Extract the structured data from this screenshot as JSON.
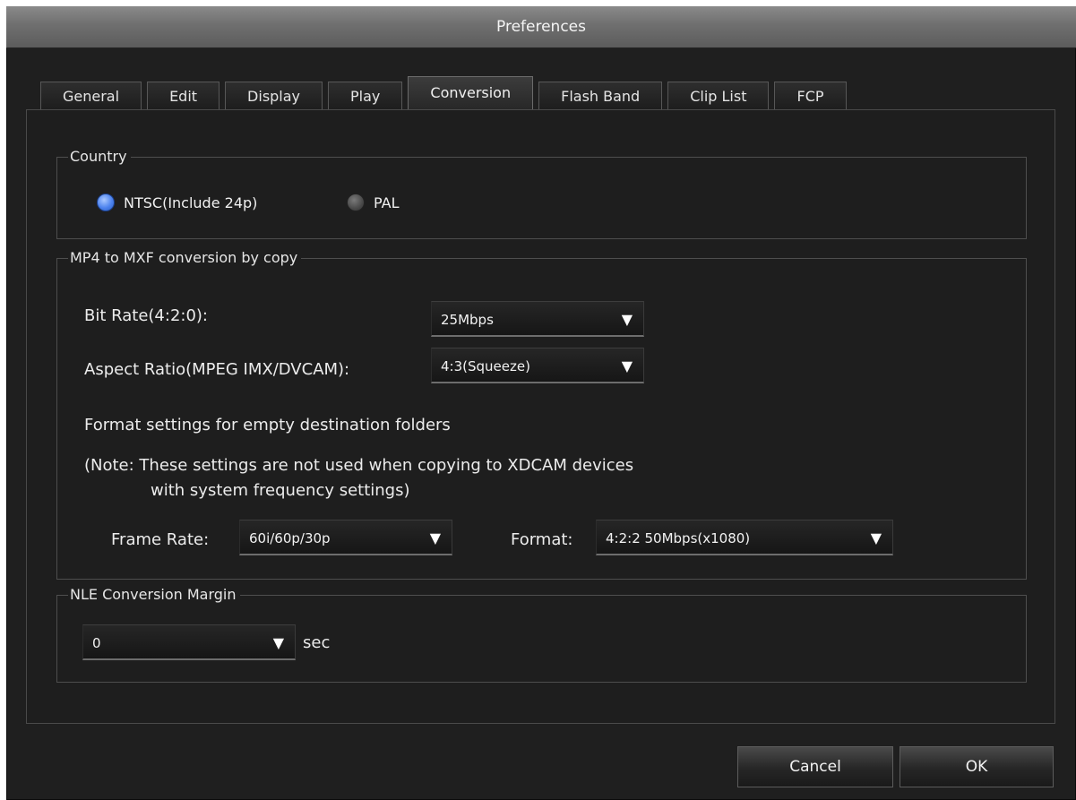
{
  "window": {
    "title": "Preferences"
  },
  "tabs": [
    {
      "label": "General",
      "active": false
    },
    {
      "label": "Edit",
      "active": false
    },
    {
      "label": "Display",
      "active": false
    },
    {
      "label": "Play",
      "active": false
    },
    {
      "label": "Conversion",
      "active": true
    },
    {
      "label": "Flash Band",
      "active": false
    },
    {
      "label": "Clip List",
      "active": false
    },
    {
      "label": "FCP",
      "active": false
    }
  ],
  "country": {
    "legend": "Country",
    "options": [
      {
        "label": "NTSC(Include 24p)",
        "selected": true
      },
      {
        "label": "PAL",
        "selected": false
      }
    ]
  },
  "mp4": {
    "legend": "MP4 to MXF conversion by copy",
    "bitrate_label": "Bit Rate(4:2:0):",
    "bitrate_value": "25Mbps",
    "aspect_label": "Aspect Ratio(MPEG IMX/DVCAM):",
    "aspect_value": "4:3(Squeeze)",
    "format_heading": "Format settings for empty destination folders",
    "note_line1": "(Note: These settings are not used when copying to XDCAM devices",
    "note_line2": "with system frequency settings)",
    "framerate_label": "Frame Rate:",
    "framerate_value": "60i/60p/30p",
    "format_label": "Format:",
    "format_value": "4:2:2 50Mbps(x1080)"
  },
  "nle": {
    "legend": "NLE Conversion Margin",
    "value": "0",
    "unit": "sec"
  },
  "buttons": {
    "cancel": "Cancel",
    "ok": "OK"
  },
  "icons": {
    "dropdown": "▼"
  }
}
